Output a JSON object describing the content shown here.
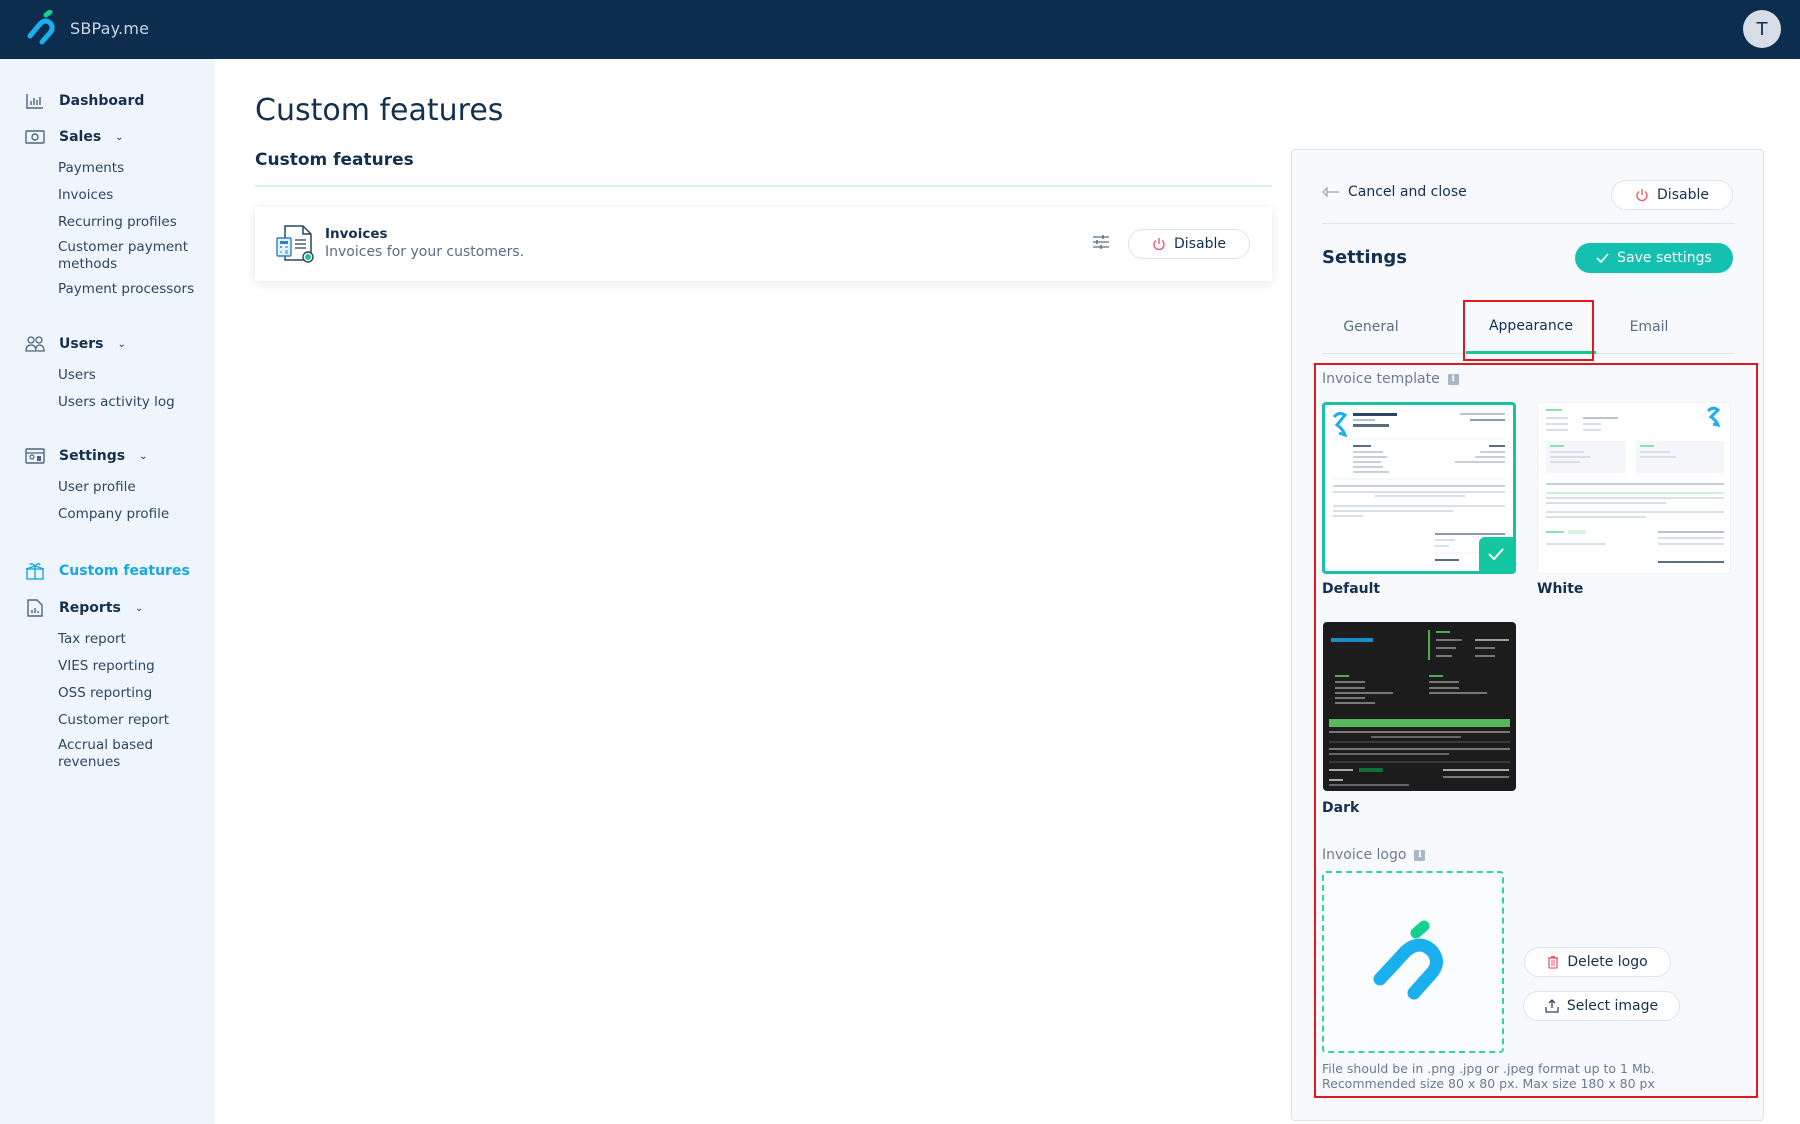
{
  "app": {
    "name": "SBPay.me",
    "user_initial": "T"
  },
  "sidebar": {
    "groups": [
      {
        "label": "Dashboard",
        "icon": "bar-chart-icon",
        "items": []
      },
      {
        "label": "Sales",
        "icon": "money-icon",
        "expandable": true,
        "items": [
          "Payments",
          "Invoices",
          "Recurring profiles",
          "Customer payment methods",
          "Payment processors"
        ]
      },
      {
        "label": "Users",
        "icon": "users-icon",
        "expandable": true,
        "items": [
          "Users",
          "Users activity log"
        ]
      },
      {
        "label": "Settings",
        "icon": "id-card-icon",
        "expandable": true,
        "items": [
          "User profile",
          "Company profile"
        ]
      },
      {
        "label": "Custom features",
        "icon": "gift-box-icon",
        "active": true,
        "items": []
      },
      {
        "label": "Reports",
        "icon": "report-file-icon",
        "expandable": true,
        "items": [
          "Tax report",
          "VIES reporting",
          "OSS reporting",
          "Customer report",
          "Accrual based revenues"
        ]
      }
    ],
    "active_color": "#1aa6e0"
  },
  "main": {
    "page_title": "Custom features",
    "section_title": "Custom features",
    "feature": {
      "name": "Invoices",
      "description": "Invoices for your customers.",
      "disable_label": "Disable"
    }
  },
  "panel": {
    "cancel_label": "Cancel and close",
    "disable_label": "Disable",
    "settings_title": "Settings",
    "save_label": "Save settings",
    "tabs": [
      {
        "label": "General",
        "active": false
      },
      {
        "label": "Appearance",
        "active": true
      },
      {
        "label": "Email",
        "active": false
      }
    ],
    "invoice_template_label": "Invoice template",
    "templates": [
      {
        "name": "Default",
        "selected": true
      },
      {
        "name": "White",
        "selected": false
      },
      {
        "name": "Dark",
        "selected": false
      }
    ],
    "invoice_logo_label": "Invoice logo",
    "delete_logo_label": "Delete logo",
    "select_image_label": "Select image",
    "file_hint_line1": "File should be in .png .jpg or .jpeg format up to 1 Mb.",
    "file_hint_line2": "Recommended size 80 x 80 px. Max size 180 x 80 px"
  },
  "colors": {
    "topbar": "#0d2d4f",
    "accent_green": "#14c1b0",
    "highlight_red": "#e0191e"
  }
}
